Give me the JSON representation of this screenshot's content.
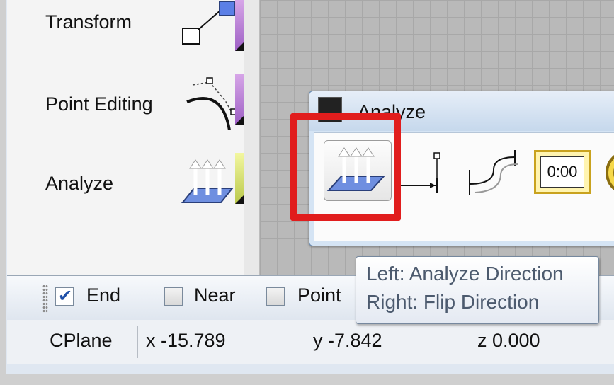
{
  "sidebar": {
    "items": [
      {
        "label": "Transform",
        "icon": "transform-icon"
      },
      {
        "label": "Point Editing",
        "icon": "point-editing-icon"
      },
      {
        "label": "Analyze",
        "icon": "analyze-direction-icon"
      }
    ]
  },
  "floating_toolbar": {
    "title": "Analyze",
    "timer_label": "0:00",
    "buttons": [
      "analyze-direction-icon",
      "distance-icon",
      "curvature-icon",
      "timer-icon",
      "stopwatch-icon"
    ]
  },
  "osnap": {
    "items": [
      {
        "label": "End",
        "checked": true
      },
      {
        "label": "Near",
        "checked": false
      },
      {
        "label": "Point",
        "checked": false
      }
    ]
  },
  "status": {
    "cplane": "CPlane",
    "x": "x -15.789",
    "y": "y -7.842",
    "z": "z 0.000"
  },
  "tooltip": {
    "left": "Left: Analyze Direction",
    "right": "Right: Flip Direction"
  },
  "colors": {
    "highlight": "#e11d1d",
    "flyout_purple": "#9d5fc4",
    "analyze_blue": "#6f8fe0"
  }
}
